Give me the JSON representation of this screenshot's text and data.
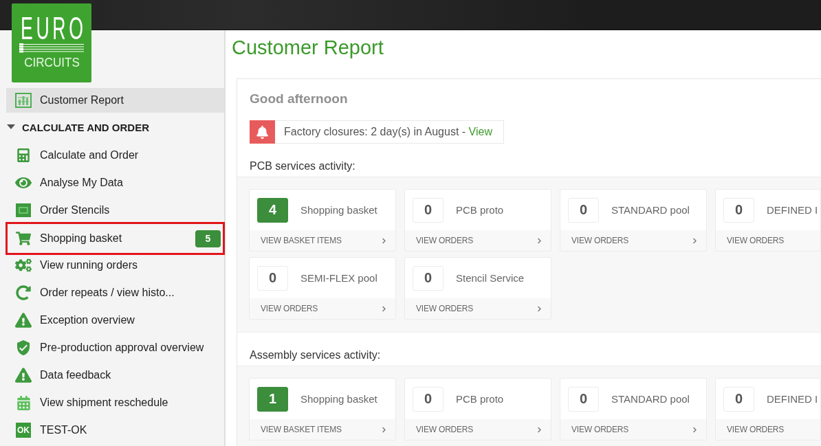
{
  "logo": {
    "line_1": "EURO",
    "line_2": "CIRCUITS"
  },
  "sidebar": {
    "items": [
      {
        "label": "Customer Report",
        "selected": true
      }
    ],
    "section": {
      "title": "CALCULATE AND ORDER",
      "expanded": true,
      "items": [
        {
          "label": "Calculate and Order",
          "selected": false,
          "highlighted": false
        },
        {
          "label": "Analyse My Data",
          "selected": false,
          "highlighted": false
        },
        {
          "label": "Order Stencils",
          "selected": false,
          "highlighted": false
        },
        {
          "label": "Shopping basket",
          "selected": false,
          "highlighted": true,
          "badge": "5"
        },
        {
          "label": "View running orders",
          "selected": false,
          "highlighted": false
        },
        {
          "label": "Order repeats / view histo...",
          "selected": false,
          "highlighted": false
        },
        {
          "label": "Exception overview",
          "selected": false,
          "highlighted": false
        },
        {
          "label": "Pre-production approval overview",
          "selected": false,
          "highlighted": false
        },
        {
          "label": "Data feedback",
          "selected": false,
          "highlighted": false
        },
        {
          "label": "View shipment reschedule",
          "selected": false,
          "highlighted": false
        },
        {
          "label": "TEST-OK",
          "selected": false,
          "highlighted": false,
          "icon_label": "OK"
        }
      ]
    }
  },
  "main": {
    "title": "Customer Report",
    "greeting": "Good afternoon",
    "notice": {
      "text": "Factory closures: 2 day(s) in August -",
      "link": "View"
    },
    "sections": [
      {
        "title": "PCB services activity:",
        "cards": [
          {
            "kind": "basket",
            "count": "4",
            "label": "Shopping basket",
            "action": "VIEW BASKET ITEMS",
            "chevron": true
          },
          {
            "kind": "orders",
            "count": "0",
            "label": "PCB proto",
            "action": "VIEW ORDERS",
            "chevron": true
          },
          {
            "kind": "orders",
            "count": "0",
            "label": "STANDARD pool",
            "action": "VIEW ORDERS",
            "chevron": true
          },
          {
            "kind": "orders",
            "count": "0",
            "label": "DEFINED I",
            "action": "VIEW ORDERS",
            "chevron": false
          },
          {
            "kind": "orders",
            "count": "0",
            "label": "SEMI-FLEX pool",
            "action": "VIEW ORDERS",
            "chevron": true
          },
          {
            "kind": "orders",
            "count": "0",
            "label": "Stencil Service",
            "action": "VIEW ORDERS",
            "chevron": true
          }
        ]
      },
      {
        "title": "Assembly services activity:",
        "cards": [
          {
            "kind": "basket",
            "count": "1",
            "label": "Shopping basket",
            "action": "VIEW BASKET ITEMS",
            "chevron": true
          },
          {
            "kind": "orders",
            "count": "0",
            "label": "PCB proto",
            "action": "VIEW ORDERS",
            "chevron": true
          },
          {
            "kind": "orders",
            "count": "0",
            "label": "STANDARD pool",
            "action": "VIEW ORDERS",
            "chevron": true
          },
          {
            "kind": "orders",
            "count": "0",
            "label": "DEFINED I",
            "action": "VIEW ORDERS",
            "chevron": false
          }
        ]
      }
    ]
  }
}
